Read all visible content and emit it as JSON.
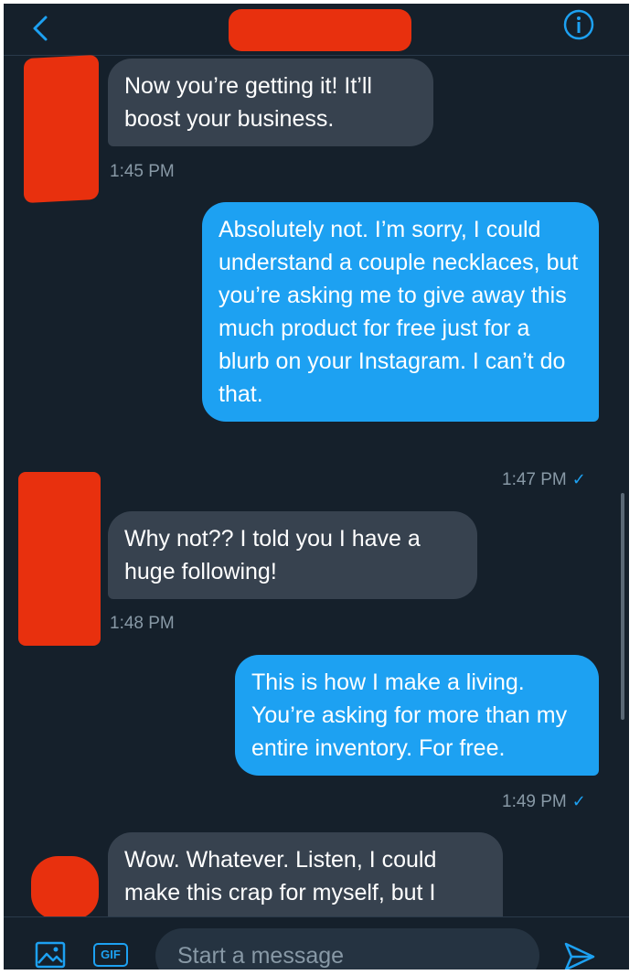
{
  "composer": {
    "placeholder": "Start a message"
  },
  "icons": {
    "back": "chevron-left-icon",
    "info": "info-icon",
    "media": "image-icon",
    "gif": "GIF",
    "send": "send-icon"
  },
  "messages": [
    {
      "direction": "received",
      "text": "Now you’re getting it! It’ll boost your business.",
      "time": "1:45 PM"
    },
    {
      "direction": "sent",
      "text": "Absolutely not. I’m sorry, I could understand a couple necklaces, but you’re asking me to give away this much product for free just for a blurb on your Instagram. I can’t do that.",
      "time": "1:47 PM",
      "status": "✓"
    },
    {
      "direction": "received",
      "text": "Why not?? I told you I have a huge following!",
      "time": "1:48 PM"
    },
    {
      "direction": "sent",
      "text": "This is how I make a living. You’re asking for more than my entire inventory. For free.",
      "time": "1:49 PM",
      "status": "✓"
    },
    {
      "direction": "received",
      "text": "Wow. Whatever. Listen, I could make this crap for myself, but I"
    }
  ],
  "colors": {
    "background": "#15202b",
    "received_bubble": "#37424f",
    "sent_bubble": "#1da1f2",
    "accent": "#1da1f2",
    "redaction": "#e8300e"
  }
}
